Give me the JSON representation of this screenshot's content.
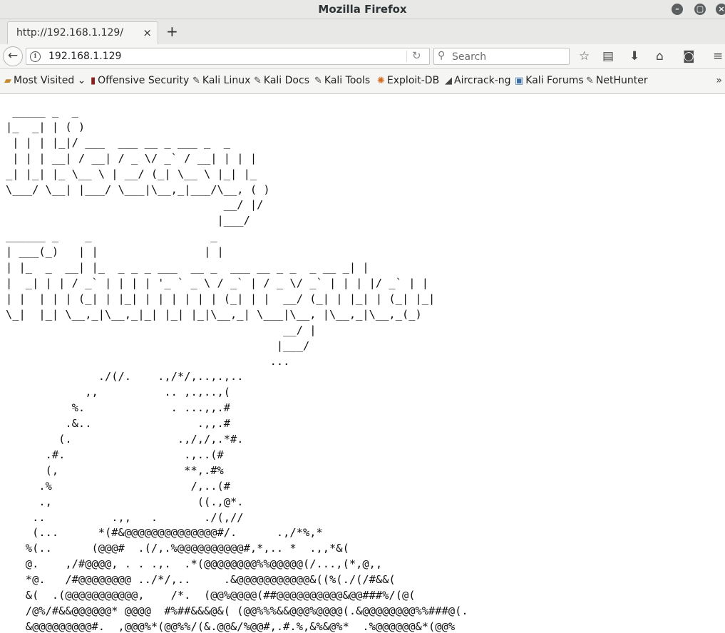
{
  "window": {
    "title": "Mozilla Firefox",
    "minimize_icon": "minimize-icon",
    "maximize_icon": "maximize-icon",
    "close_icon": "close-icon"
  },
  "tab": {
    "title": "http://192.168.1.129/",
    "close": "×",
    "new_tab": "+"
  },
  "navbar": {
    "url": "192.168.1.129",
    "search_placeholder": "Search"
  },
  "bookmarks": [
    {
      "label": "Most Visited",
      "icon": "folder-icon"
    },
    {
      "label": "Offensive Security",
      "icon": "offsec-icon"
    },
    {
      "label": "Kali Linux",
      "icon": "kali-icon"
    },
    {
      "label": "Kali Docs",
      "icon": "kali-icon"
    },
    {
      "label": "Kali Tools",
      "icon": "kali-icon"
    },
    {
      "label": "Exploit-DB",
      "icon": "exploitdb-icon"
    },
    {
      "label": "Aircrack-ng",
      "icon": "aircrack-icon"
    },
    {
      "label": "Kali Forums",
      "icon": "kali-forums-icon"
    },
    {
      "label": "NetHunter",
      "icon": "kali-icon"
    }
  ],
  "page": {
    "ascii_art": " _____ _  _\n|_  _| | ( )\n | | | |_|/ ___  ___ __ _ ___ _  _\n | | | __| / __| / _ \\/ _` / __| | | |\n_| |_| |_ \\__ \\ | __/ (_| \\__ \\ |_| |_\n\\___/ \\__| |___/ \\___|\\__,_|___/\\__, ( )\n                                 __/ |/\n                                |___/\n______ _    _                  _\n| ___(_)   | |                | |\n| |_  _  __| |_  _ _ _ ___  __ _  ___ __ _ _  _ __ _| |\n|  _| | | / _` | | | | '_ ` _ \\ / _` | / _ \\/ _` | | | |/ _` | |\n| |  | | | (_| | |_| | | | | | | (_| | |  __/ (_| | |_| | (_| |_|\n\\_|  |_| \\__,_|\\__,_|_| |_| |_|\\__,_| \\___|\\__, |\\__,_|\\__,_(_)\n                                          __/ |\n                                         |___/\n                                        ...\n              ./(/.    .,/*/,..,.,..\n            ,,          .. ,.,..,(\n          %.             . ...,,.#\n         .&..                .,,.#\n        (.                .,/,/,.*#.\n      .#.                  .,..(#\n      (,                   **,.#%\n     .%                     /,..(#\n     .,                      ((.,@*.\n    ..          .,,   .       ./(,//\n    (...      *(#&@@@@@@@@@@@@@@#/.      .,/*%,*\n   %(..      (@@@#  .(/,.%@@@@@@@@@@#,*,.. *  .,,*&(\n   @.    ,/#@@@@, . . .,.  .*(@@@@@@@@%%@@@@@(/...,(*,@,,\n   *@.   /#@@@@@@@@ ../*/,..     .&@@@@@@@@@@@&((%(./(/#&&(\n   &(  .(@@@@@@@@@@@,    /*.  (@@%@@@@(##@@@@@@@@@@&@@###%/(@(\n   /@%/#&&@@@@@@* @@@@  #%##&&&@&( (@@%%%&&@@@%@@@@(.&@@@@@@@@%%###@(.\n   &@@@@@@@@@#.  ,@@@%*(@@%%/(&.@@&/%@@#,.#.%,&%&@%*  .%@@@@@@&*(@@%"
  }
}
